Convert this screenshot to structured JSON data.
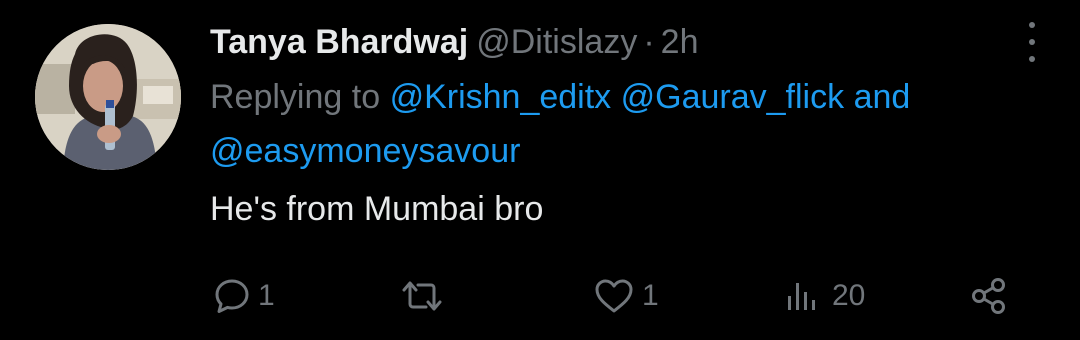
{
  "tweet": {
    "display_name": "Tanya Bhardwaj",
    "handle": "@Ditislazy",
    "separator": "·",
    "time": "2h",
    "replying_prefix": "Replying to",
    "mentions": [
      "@Krishn_editx",
      "@Gaurav_flick",
      "@easymoneysavour"
    ],
    "mentions_joiner": "and",
    "text": "He's from Mumbai bro"
  },
  "actions": {
    "reply_count": "1",
    "retweet_count": "",
    "like_count": "1",
    "views_count": "20"
  },
  "icons": [
    "more-icon",
    "reply-icon",
    "retweet-icon",
    "like-icon",
    "views-icon",
    "share-icon"
  ],
  "colors": {
    "background": "#000000",
    "primary_text": "#e7e9ea",
    "secondary_text": "#71767b",
    "link": "#1d9bf0"
  }
}
